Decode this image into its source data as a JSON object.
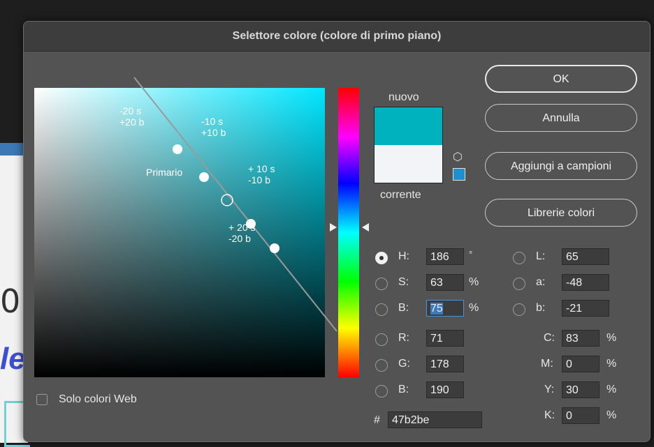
{
  "background": {
    "fragments": [
      "0",
      "le"
    ]
  },
  "dialog": {
    "title": "Selettore colore (colore di primo piano)"
  },
  "field": {
    "labels": {
      "minus20s": "-20 s\n+20 b",
      "minus10s": "-10 s\n+10 b",
      "primario": "Primario",
      "plus10s": "+ 10 s\n-10 b",
      "plus20s": "+ 20 s\n-20 b"
    }
  },
  "swatches": {
    "new_label": "nuovo",
    "current_label": "corrente",
    "new_color": "#00b2be",
    "current_color": "#f2f4f7"
  },
  "buttons": {
    "ok": "OK",
    "cancel": "Annulla",
    "add_swatches": "Aggiungi a campioni",
    "libraries": "Librerie colori"
  },
  "hsb": {
    "h": {
      "label": "H:",
      "value": "186",
      "unit": "°"
    },
    "s": {
      "label": "S:",
      "value": "63",
      "unit": "%"
    },
    "b": {
      "label": "B:",
      "value": "75",
      "unit": "%"
    }
  },
  "rgb": {
    "r": {
      "label": "R:",
      "value": "71"
    },
    "g": {
      "label": "G:",
      "value": "178"
    },
    "b": {
      "label": "B:",
      "value": "190"
    }
  },
  "lab": {
    "l": {
      "label": "L:",
      "value": "65"
    },
    "a": {
      "label": "a:",
      "value": "-48"
    },
    "b": {
      "label": "b:",
      "value": "-21"
    }
  },
  "cmyk": {
    "c": {
      "label": "C:",
      "value": "83",
      "unit": "%"
    },
    "m": {
      "label": "M:",
      "value": "0",
      "unit": "%"
    },
    "y": {
      "label": "Y:",
      "value": "30",
      "unit": "%"
    },
    "k": {
      "label": "K:",
      "value": "0",
      "unit": "%"
    }
  },
  "hex": {
    "prefix": "#",
    "value": "47b2be"
  },
  "web_only": {
    "label": "Solo colori Web",
    "checked": false
  }
}
